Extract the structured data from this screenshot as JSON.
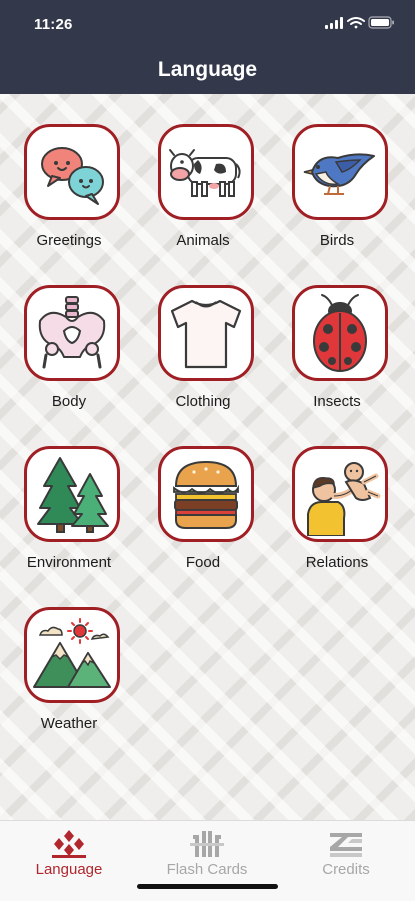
{
  "status_bar": {
    "time": "11:26"
  },
  "header": {
    "title": "Language"
  },
  "categories": [
    {
      "label": "Greetings",
      "icon": "speech-bubbles-icon"
    },
    {
      "label": "Animals",
      "icon": "cow-icon"
    },
    {
      "label": "Birds",
      "icon": "bluebird-icon"
    },
    {
      "label": "Body",
      "icon": "pelvis-bone-icon"
    },
    {
      "label": "Clothing",
      "icon": "tshirt-icon"
    },
    {
      "label": "Insects",
      "icon": "ladybug-icon"
    },
    {
      "label": "Environment",
      "icon": "pine-trees-icon"
    },
    {
      "label": "Food",
      "icon": "burger-icon"
    },
    {
      "label": "Relations",
      "icon": "parent-child-icon"
    },
    {
      "label": "Weather",
      "icon": "mountains-sun-icon"
    }
  ],
  "tabs": [
    {
      "label": "Language",
      "icon": "language-pattern-icon",
      "active": true
    },
    {
      "label": "Flash Cards",
      "icon": "flash-cards-icon",
      "active": false
    },
    {
      "label": "Credits",
      "icon": "credits-pattern-icon",
      "active": false
    }
  ],
  "colors": {
    "header_bg": "#33394a",
    "tile_border": "#a01f24",
    "tab_active": "#b0272d",
    "tab_inactive": "#a7a7a7"
  }
}
